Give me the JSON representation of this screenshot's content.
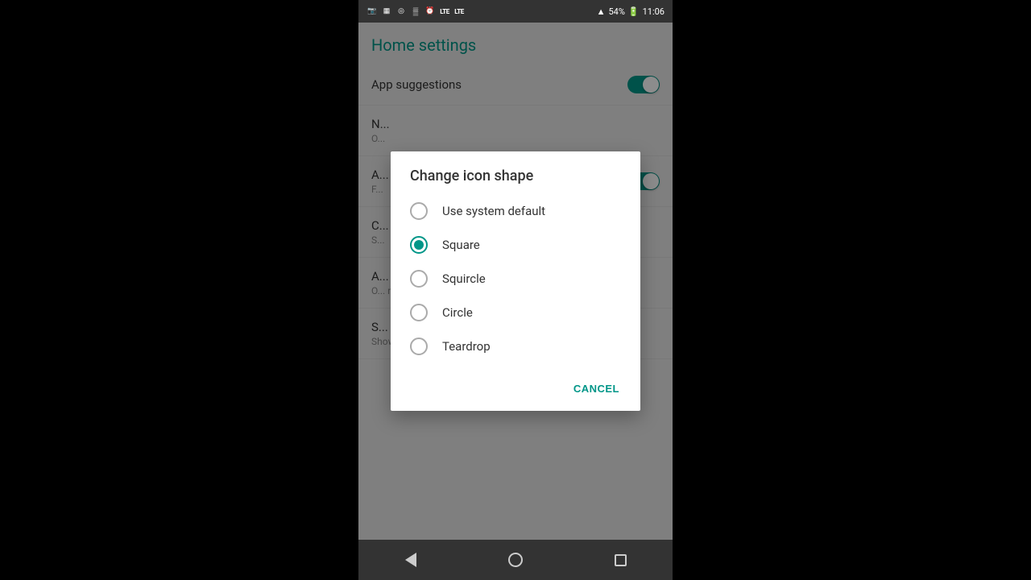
{
  "statusBar": {
    "time": "11:06",
    "battery": "54%",
    "leftIcons": [
      "video-camera",
      "cast",
      "wifi",
      "vibrate",
      "alarm",
      "lte1",
      "lte2",
      "signal",
      "signal-triangle"
    ]
  },
  "appBar": {
    "title": "Home settings"
  },
  "settingsItems": [
    {
      "label": "App suggestions",
      "sublabel": "",
      "hasToggle": true,
      "toggleOn": true
    },
    {
      "label": "N...",
      "sublabel": "O...",
      "hasToggle": false,
      "toggleOn": false
    },
    {
      "label": "A...",
      "sublabel": "F...",
      "hasToggle": false,
      "toggleOn": false
    },
    {
      "label": "C...",
      "sublabel": "S...",
      "hasToggle": false,
      "toggleOn": false
    },
    {
      "label": "A...",
      "sublabel": "O... r...",
      "hasToggle": false,
      "toggleOn": false
    },
    {
      "label": "S...",
      "sublabel": "Show nothing to the left of the home screen",
      "hasToggle": false,
      "toggleOn": false
    }
  ],
  "dialog": {
    "title": "Change icon shape",
    "options": [
      {
        "id": "system-default",
        "label": "Use system default",
        "selected": false
      },
      {
        "id": "square",
        "label": "Square",
        "selected": true
      },
      {
        "id": "squircle",
        "label": "Squircle",
        "selected": false
      },
      {
        "id": "circle",
        "label": "Circle",
        "selected": false
      },
      {
        "id": "teardrop",
        "label": "Teardrop",
        "selected": false
      }
    ],
    "cancelLabel": "CANCEL"
  },
  "navBar": {
    "backLabel": "back",
    "homeLabel": "home",
    "recentsLabel": "recents"
  },
  "accentColor": "#009688"
}
